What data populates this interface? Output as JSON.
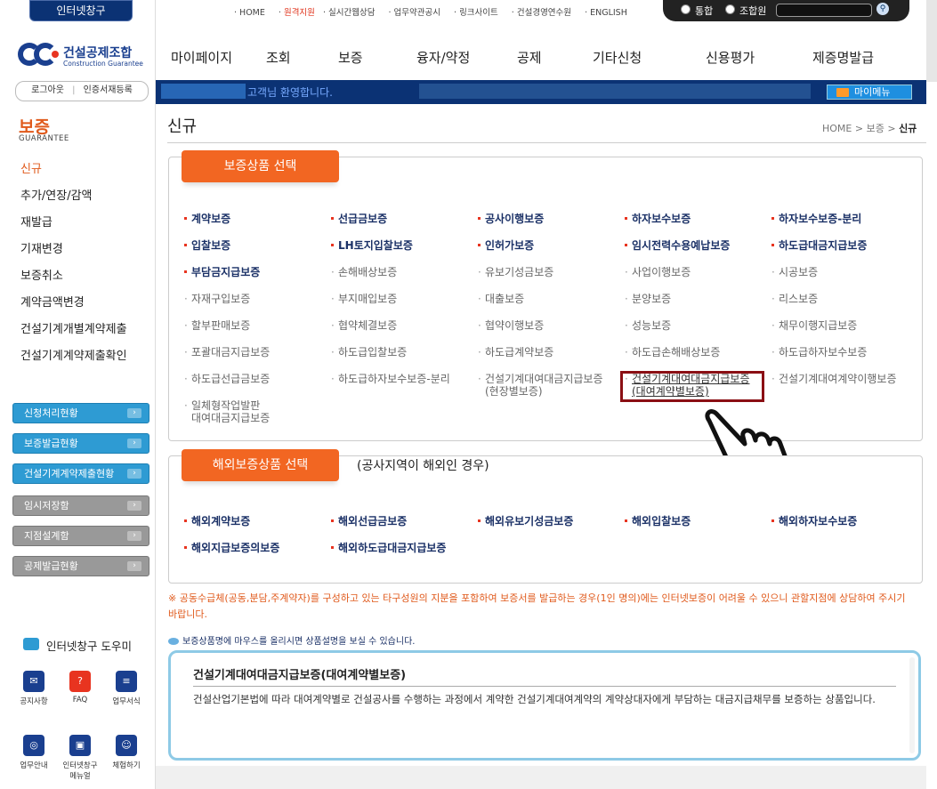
{
  "util": {
    "badge": "인터넷창구",
    "links": [
      "HOME",
      "원격지원",
      "실시간웹상담",
      "업무약관공시",
      "링크사이트",
      "건설경영연수원",
      "ENGLISH"
    ],
    "radio_total": "통합",
    "radio_member": "조합원"
  },
  "logo": {
    "kr": "건설공제조합",
    "en": "Construction Guarantee"
  },
  "nav": [
    "마이페이지",
    "조회",
    "보증",
    "융자/약정",
    "공제",
    "기타신청",
    "신용평가",
    "제증명발급"
  ],
  "welcome": {
    "message": "고객님 환영합니다.",
    "mymenu": "마이메뉴"
  },
  "login": {
    "logout": "로그아웃",
    "cert": "인증서재등록"
  },
  "side": {
    "section": "보증",
    "section_en": "GUARANTEE",
    "menu": [
      "신규",
      "추가/연장/감액",
      "재발급",
      "기재변경",
      "보증취소",
      "계약금액변경",
      "건설기계개별계약제출",
      "건설기계계약제출확인"
    ],
    "buttons": [
      "신청처리현황",
      "보증발급현황",
      "건설기계계약제출현황",
      "임시저장함",
      "지점설계함",
      "공제발급현황"
    ],
    "help_title": "인터넷창구 도우미",
    "help_icons": [
      "공지사항",
      "FAQ",
      "업무서식",
      "업무안내",
      "인터넷창구 메뉴얼",
      "체험하기"
    ]
  },
  "page": {
    "title": "신규",
    "crumb": [
      "HOME",
      "보증",
      "신규"
    ]
  },
  "domestic": {
    "tab": "보증상품 선택",
    "rows": [
      [
        "계약보증",
        "선급금보증",
        "공사이행보증",
        "하자보수보증",
        "하자보수보증-분리"
      ],
      [
        "입찰보증",
        "LH토지입찰보증",
        "인허가보증",
        "임시전력수용예납보증",
        "하도급대금지급보증"
      ],
      [
        "부담금지급보증",
        "손해배상보증",
        "유보기성금보증",
        "사업이행보증",
        "시공보증"
      ],
      [
        "자재구입보증",
        "부지매입보증",
        "대출보증",
        "분양보증",
        "리스보증"
      ],
      [
        "할부판매보증",
        "협약체결보증",
        "협약이행보증",
        "성능보증",
        "채무이행지급보증"
      ],
      [
        "포괄대금지급보증",
        "하도급입찰보증",
        "하도급계약보증",
        "하도급손해배상보증",
        "하도급하자보수보증"
      ],
      [
        "하도급선급금보증",
        "하도급하자보수보증-분리",
        "건설기계대여대금지급보증\n(현장별보증)",
        "건설기계대여대금지급보증\n(대여계약별보증)",
        "건설기계대여계약이행보증"
      ],
      [
        "일체형작업발판\n대여대금지급보증"
      ]
    ]
  },
  "overseas": {
    "tab": "해외보증상품 선택",
    "note": "(공사지역이 해외인 경우)",
    "rows": [
      [
        "해외계약보증",
        "해외선급금보증",
        "해외유보기성금보증",
        "해외입찰보증",
        "해외하자보수보증"
      ],
      [
        "해외지급보증의보증",
        "해외하도급대금지급보증"
      ]
    ]
  },
  "warning": "※ 공동수급체(공동,분담,주계약자)를 구성하고 있는 타구성원의 지분을 포함하여 보증서를 발급하는 경우(1인 명의)에는 인터넷보증이 어려울 수 있으니 관할지점에 상담하여 주시기 바랍니다.",
  "hint": "보증상품명에 마우스를 올리시면 상품설명을 보실 수 있습니다.",
  "desc": {
    "title": "건설기계대여대금지급보증(대여계약별보증)",
    "text": "건설산업기본법에 따라 대여계약별로 건설공사를 수행하는 과정에서 계약한 건설기계대여계약의 계약상대자에게 부담하는 대금지급채무를 보증하는 상품입니다."
  },
  "colors": {
    "navy": "#0b3274",
    "orange": "#f26622",
    "highlight": "#8b0f14",
    "sky": "#2e9bd3"
  }
}
